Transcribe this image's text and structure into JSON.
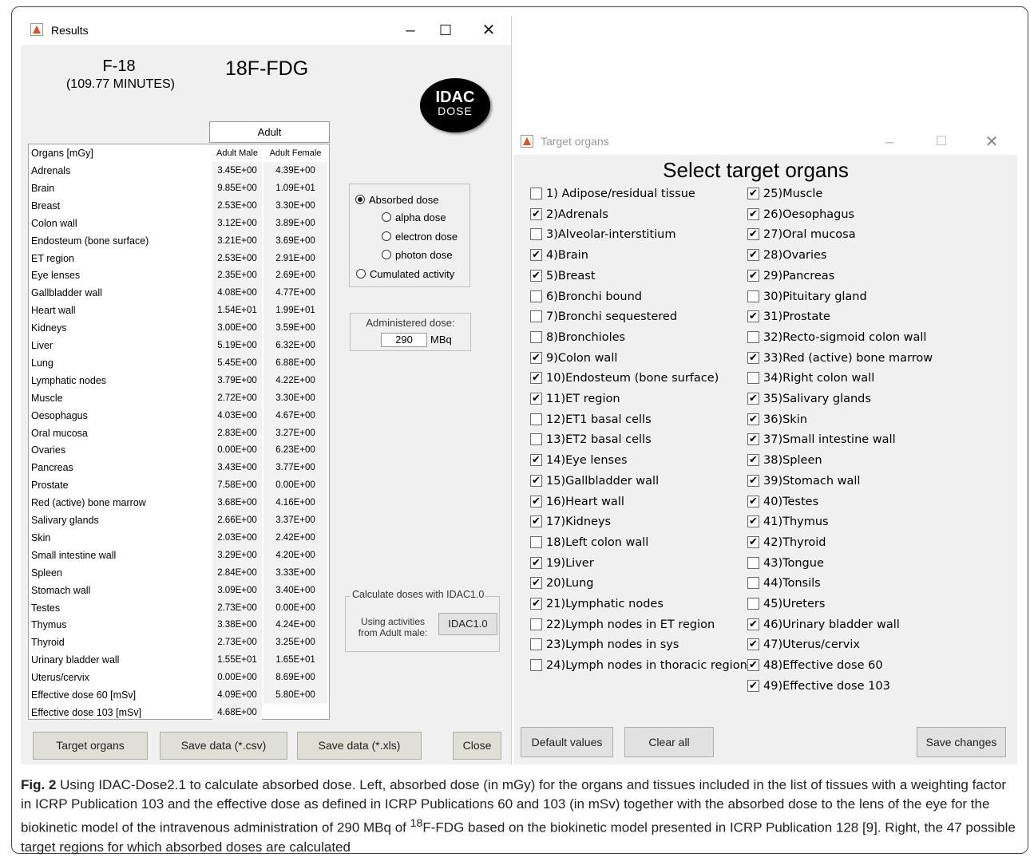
{
  "results_window": {
    "title": "Results",
    "isotope": "F-18",
    "half_life": "(109.77 MINUTES)",
    "drug": "18F-FDG",
    "logo": {
      "line1": "IDAC",
      "line2": "DOSE"
    },
    "adult_label": "Adult",
    "table_headers": {
      "organ": "Organs [mGy]",
      "male": "Adult Male",
      "female": "Adult Female"
    },
    "rows": [
      {
        "organ": "Adrenals",
        "male": "3.45E+00",
        "female": "4.39E+00"
      },
      {
        "organ": "Brain",
        "male": "9.85E+00",
        "female": "1.09E+01"
      },
      {
        "organ": "Breast",
        "male": "2.53E+00",
        "female": "3.30E+00"
      },
      {
        "organ": "Colon wall",
        "male": "3.12E+00",
        "female": "3.89E+00"
      },
      {
        "organ": "Endosteum (bone surface)",
        "male": "3.21E+00",
        "female": "3.69E+00"
      },
      {
        "organ": "ET region",
        "male": "2.53E+00",
        "female": "2.91E+00"
      },
      {
        "organ": "Eye lenses",
        "male": "2.35E+00",
        "female": "2.69E+00"
      },
      {
        "organ": "Gallbladder wall",
        "male": "4.08E+00",
        "female": "4.77E+00"
      },
      {
        "organ": "Heart wall",
        "male": "1.54E+01",
        "female": "1.99E+01"
      },
      {
        "organ": "Kidneys",
        "male": "3.00E+00",
        "female": "3.59E+00"
      },
      {
        "organ": "Liver",
        "male": "5.19E+00",
        "female": "6.32E+00"
      },
      {
        "organ": "Lung",
        "male": "5.45E+00",
        "female": "6.88E+00"
      },
      {
        "organ": "Lymphatic nodes",
        "male": "3.79E+00",
        "female": "4.22E+00"
      },
      {
        "organ": "Muscle",
        "male": "2.72E+00",
        "female": "3.30E+00"
      },
      {
        "organ": "Oesophagus",
        "male": "4.03E+00",
        "female": "4.67E+00"
      },
      {
        "organ": "Oral mucosa",
        "male": "2.83E+00",
        "female": "3.27E+00"
      },
      {
        "organ": "Ovaries",
        "male": "0.00E+00",
        "female": "6.23E+00"
      },
      {
        "organ": "Pancreas",
        "male": "3.43E+00",
        "female": "3.77E+00"
      },
      {
        "organ": "Prostate",
        "male": "7.58E+00",
        "female": "0.00E+00"
      },
      {
        "organ": "Red (active) bone marrow",
        "male": "3.68E+00",
        "female": "4.16E+00"
      },
      {
        "organ": "Salivary glands",
        "male": "2.66E+00",
        "female": "3.37E+00"
      },
      {
        "organ": "Skin",
        "male": "2.03E+00",
        "female": "2.42E+00"
      },
      {
        "organ": "Small intestine wall",
        "male": "3.29E+00",
        "female": "4.20E+00"
      },
      {
        "organ": "Spleen",
        "male": "2.84E+00",
        "female": "3.33E+00"
      },
      {
        "organ": "Stomach wall",
        "male": "3.09E+00",
        "female": "3.40E+00"
      },
      {
        "organ": "Testes",
        "male": "2.73E+00",
        "female": "0.00E+00"
      },
      {
        "organ": "Thymus",
        "male": "3.38E+00",
        "female": "4.24E+00"
      },
      {
        "organ": "Thyroid",
        "male": "2.73E+00",
        "female": "3.25E+00"
      },
      {
        "organ": "Urinary bladder wall",
        "male": "1.55E+01",
        "female": "1.65E+01"
      },
      {
        "organ": "Uterus/cervix",
        "male": "0.00E+00",
        "female": "8.69E+00"
      },
      {
        "organ": "Effective dose 60 [mSv]",
        "male": "4.09E+00",
        "female": "5.80E+00"
      },
      {
        "organ": "Effective dose 103 [mSv]",
        "male": "4.68E+00",
        "female": ""
      }
    ],
    "dose_options": [
      {
        "label": "Absorbed dose",
        "selected": true
      },
      {
        "label": "alpha dose",
        "selected": false
      },
      {
        "label": "electron dose",
        "selected": false
      },
      {
        "label": "photon dose",
        "selected": false
      },
      {
        "label": "Cumulated activity",
        "selected": false
      }
    ],
    "administered_label": "Administered dose:",
    "administered_value": "290",
    "administered_unit": "MBq",
    "calc_legend": "Calculate doses with IDAC1.0",
    "calc_text_1": "Using activities",
    "calc_text_2": "from Adult male:",
    "idac_button": "IDAC1.0",
    "buttons": {
      "target_organs": "Target organs",
      "save_csv": "Save data (*.csv)",
      "save_xls": "Save data (*.xls)",
      "close": "Close"
    }
  },
  "target_window": {
    "title": "Target organs",
    "heading": "Select target organs",
    "organs": [
      {
        "label": "1) Adipose/residual tissue",
        "checked": false
      },
      {
        "label": "2)Adrenals",
        "checked": true
      },
      {
        "label": "3)Alveolar-interstitium",
        "checked": false
      },
      {
        "label": "4)Brain",
        "checked": true
      },
      {
        "label": "5)Breast",
        "checked": true
      },
      {
        "label": "6)Bronchi bound",
        "checked": false
      },
      {
        "label": "7)Bronchi sequestered",
        "checked": false
      },
      {
        "label": "8)Bronchioles",
        "checked": false
      },
      {
        "label": "9)Colon wall",
        "checked": true
      },
      {
        "label": "10)Endosteum (bone surface)",
        "checked": true
      },
      {
        "label": "11)ET region",
        "checked": true
      },
      {
        "label": "12)ET1 basal cells",
        "checked": false
      },
      {
        "label": "13)ET2 basal cells",
        "checked": false
      },
      {
        "label": "14)Eye lenses",
        "checked": true
      },
      {
        "label": "15)Gallbladder wall",
        "checked": true
      },
      {
        "label": "16)Heart wall",
        "checked": true
      },
      {
        "label": "17)Kidneys",
        "checked": true
      },
      {
        "label": "18)Left colon wall",
        "checked": false
      },
      {
        "label": "19)Liver",
        "checked": true
      },
      {
        "label": "20)Lung",
        "checked": true
      },
      {
        "label": "21)Lymphatic nodes",
        "checked": true
      },
      {
        "label": "22)Lymph nodes in ET region",
        "checked": false
      },
      {
        "label": "23)Lymph nodes in sys",
        "checked": false
      },
      {
        "label": "24)Lymph nodes in thoracic region",
        "checked": false
      },
      {
        "label": "25)Muscle",
        "checked": true
      },
      {
        "label": "26)Oesophagus",
        "checked": true
      },
      {
        "label": "27)Oral mucosa",
        "checked": true
      },
      {
        "label": "28)Ovaries",
        "checked": true
      },
      {
        "label": "29)Pancreas",
        "checked": true
      },
      {
        "label": "30)Pituitary gland",
        "checked": false
      },
      {
        "label": "31)Prostate",
        "checked": true
      },
      {
        "label": "32)Recto-sigmoid colon wall",
        "checked": false
      },
      {
        "label": "33)Red (active) bone marrow",
        "checked": true
      },
      {
        "label": "34)Right colon wall",
        "checked": false
      },
      {
        "label": "35)Salivary glands",
        "checked": true
      },
      {
        "label": "36)Skin",
        "checked": true
      },
      {
        "label": "37)Small intestine wall",
        "checked": true
      },
      {
        "label": "38)Spleen",
        "checked": true
      },
      {
        "label": "39)Stomach wall",
        "checked": true
      },
      {
        "label": "40)Testes",
        "checked": true
      },
      {
        "label": "41)Thymus",
        "checked": true
      },
      {
        "label": "42)Thyroid",
        "checked": true
      },
      {
        "label": "43)Tongue",
        "checked": false
      },
      {
        "label": "44)Tonsils",
        "checked": false
      },
      {
        "label": "45)Ureters",
        "checked": false
      },
      {
        "label": "46)Urinary bladder wall",
        "checked": true
      },
      {
        "label": "47)Uterus/cervix",
        "checked": true
      },
      {
        "label": "48)Effective dose 60",
        "checked": true
      },
      {
        "label": "49)Effective dose 103",
        "checked": true
      }
    ],
    "buttons": {
      "default": "Default values",
      "clear": "Clear all",
      "save": "Save changes"
    }
  },
  "caption": {
    "fig_label": "Fig. 2",
    "text_before_sup": " Using IDAC-Dose2.1 to calculate absorbed dose. Left, absorbed dose (in mGy) for the organs and tissues included in the list of tissues with a weighting factor in ICRP Publication 103 and the effective dose as defined in ICRP Publications 60 and 103 (in mSv) together with the absorbed dose to the lens of the eye for the biokinetic model of the intravenous administration of 290 MBq of ",
    "sup": "18",
    "text_after_sup": "F-FDG based on the biokinetic model presented in ICRP Publication 128 [9]. Right, the 47 possible target regions for which absorbed doses are calculated"
  },
  "icons": {
    "app": "matlab-icon",
    "minimize": "minimize-icon",
    "maximize": "maximize-icon",
    "close": "close-icon",
    "checkmark": "checkmark-icon"
  }
}
